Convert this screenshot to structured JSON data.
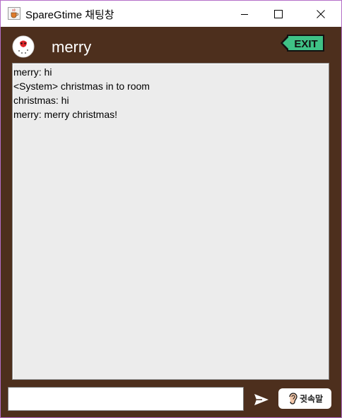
{
  "window": {
    "title": "SpareGtime 채팅창",
    "border_color": "#b46ec8",
    "background_color": "#4d2f1d"
  },
  "title_icons": {
    "app": "java-coffee-icon",
    "minimize": "minimize-icon",
    "maximize": "maximize-icon",
    "close": "close-icon"
  },
  "header": {
    "avatar_icon": "snowman-avatar-icon",
    "username": "merry",
    "exit_label": "EXIT",
    "exit_color": "#3fc286"
  },
  "chat": {
    "messages": [
      "merry: hi",
      "<System> christmas in to room",
      "christmas: hi",
      "merry: merry christmas!"
    ]
  },
  "footer": {
    "input_value": "",
    "send_icon": "send-arrow-icon",
    "whisper_icon": "ear-icon",
    "whisper_label": "귓속말"
  }
}
